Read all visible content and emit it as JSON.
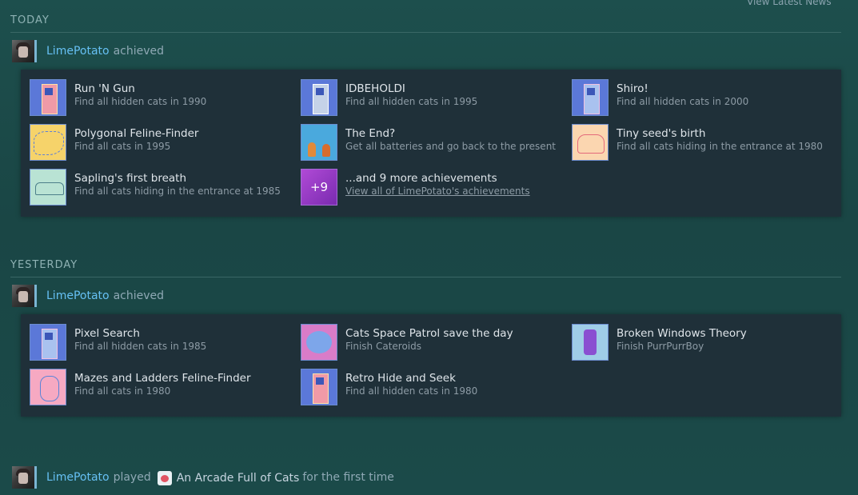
{
  "header": {
    "news_link": "View Latest News"
  },
  "sections": [
    {
      "date": "TODAY",
      "user": "LimePotato",
      "verb": "achieved",
      "achievements": [
        {
          "name": "Run 'N Gun",
          "desc": "Find all hidden cats in 1990",
          "icon": "arcade-cabinet-icon"
        },
        {
          "name": "IDBEHOLDI",
          "desc": "Find all hidden cats in 1995",
          "icon": "arcade-cabinet-icon"
        },
        {
          "name": "Shiro!",
          "desc": "Find all hidden cats in 2000",
          "icon": "arcade-cabinet-icon"
        },
        {
          "name": "Polygonal Feline-Finder",
          "desc": "Find all cats in 1995",
          "icon": "map-icon"
        },
        {
          "name": "The End?",
          "desc": "Get all batteries and go back to the present",
          "icon": "cats-car-icon"
        },
        {
          "name": "Tiny seed's birth",
          "desc": "Find all cats hiding in the entrance at 1980",
          "icon": "van-icon"
        },
        {
          "name": "Sapling's first breath",
          "desc": "Find all cats hiding in the entrance at 1985",
          "icon": "car-icon"
        }
      ],
      "more": {
        "badge": "+9",
        "label": "...and 9 more achievements",
        "link": "View all of LimePotato's achievements"
      }
    },
    {
      "date": "YESTERDAY",
      "user": "LimePotato",
      "verb": "achieved",
      "achievements": [
        {
          "name": "Pixel Search",
          "desc": "Find all hidden cats in 1985",
          "icon": "arcade-cabinet-icon"
        },
        {
          "name": "Cats Space Patrol save the day",
          "desc": "Finish Cateroids",
          "icon": "space-icon"
        },
        {
          "name": "Broken Windows Theory",
          "desc": "Finish PurrPurrBoy",
          "icon": "character-icon"
        },
        {
          "name": "Mazes and Ladders Feline-Finder",
          "desc": "Find all cats in 1980",
          "icon": "cat-map-icon"
        },
        {
          "name": "Retro Hide and Seek",
          "desc": "Find all hidden cats in 1980",
          "icon": "arcade-cabinet-icon"
        }
      ]
    }
  ],
  "played": {
    "user": "LimePotato",
    "verb": "played",
    "game": "An Arcade Full of Cats",
    "suffix": "for the first time"
  }
}
